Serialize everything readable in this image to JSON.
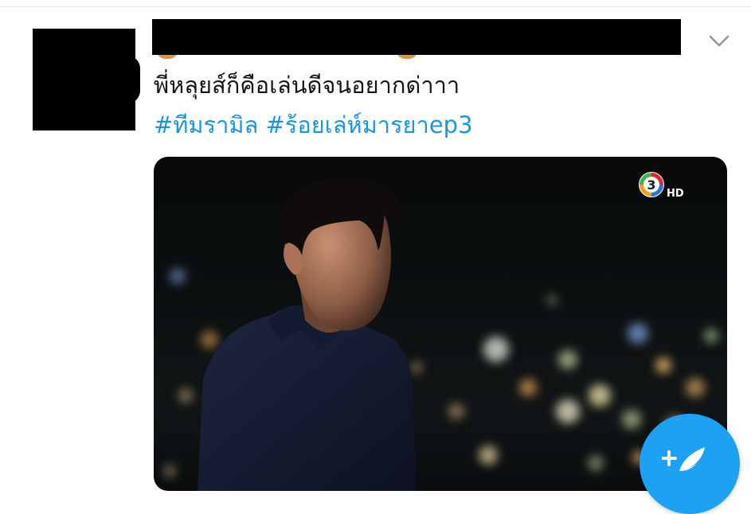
{
  "tweet": {
    "text": "พี่หลุยส์ก็คือเล่นดีจนอยากด่าาา",
    "hashtags": [
      {
        "label": "#ทีมรามิล"
      },
      {
        "label": "#ร้อยเล่ห์มารยาep3"
      }
    ]
  },
  "media": {
    "channel_logo_icon": "channel-3-hd-logo-icon",
    "channel_logo_text": "HD"
  },
  "icons": {
    "caret": "chevron-down-icon",
    "compose": "compose-tweet-icon"
  },
  "colors": {
    "link": "#1b95e0",
    "text": "#14171a",
    "fab": "#1da1f2",
    "divider": "#e6ecf0"
  }
}
